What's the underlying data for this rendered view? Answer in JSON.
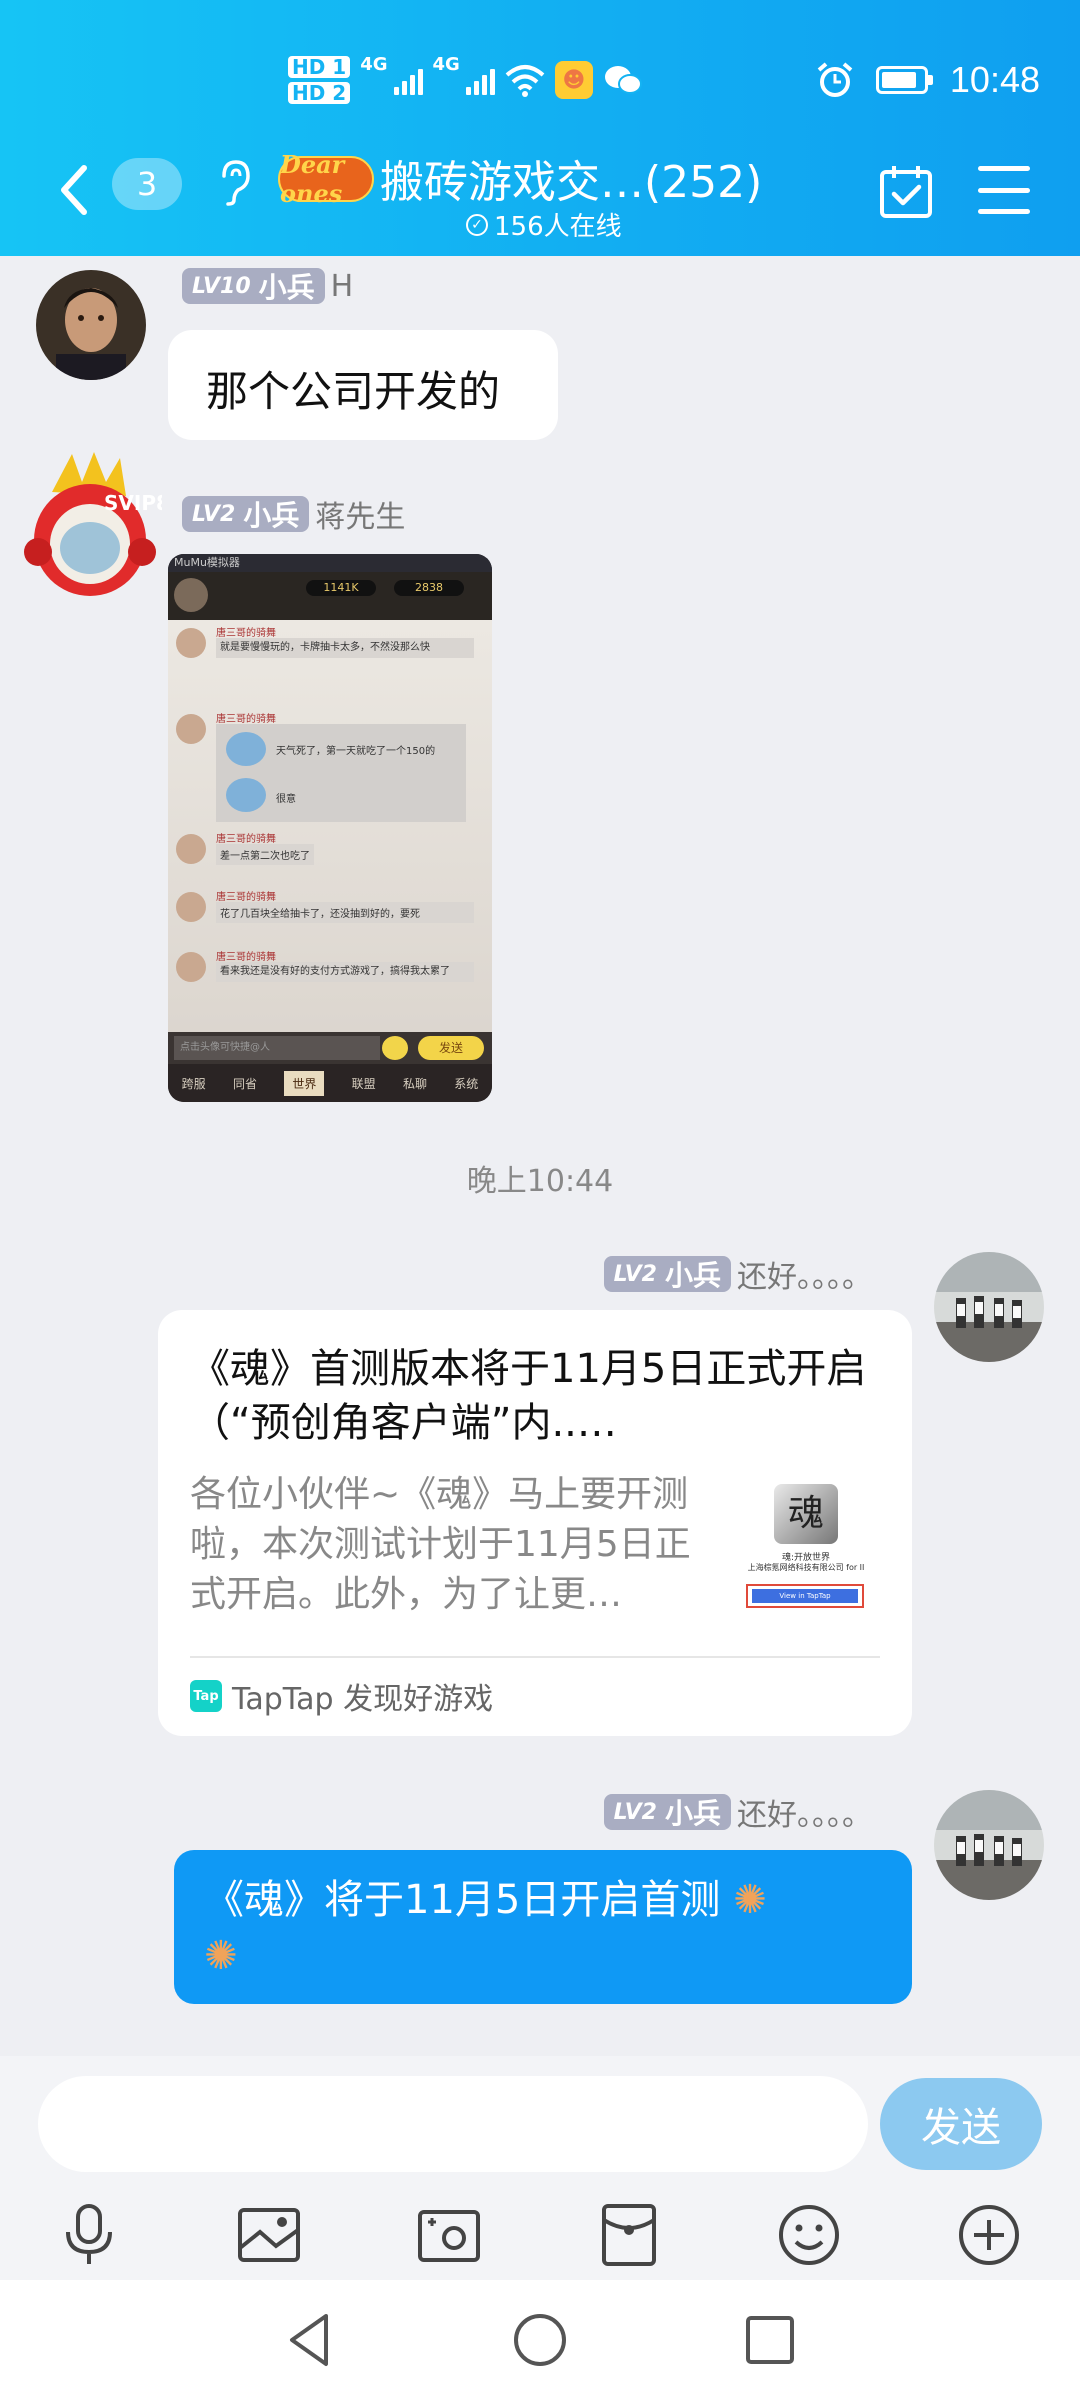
{
  "status_bar": {
    "hd1": "HD 1",
    "hd2": "HD 2",
    "net1": "4G",
    "net2": "4G",
    "time": "10:48"
  },
  "header": {
    "unread_count": "3",
    "group_logo_text": "Dear ones",
    "title": "搬砖游戏交…(252)",
    "online": "156人在线"
  },
  "messages": [
    {
      "level": "LV10",
      "rank": "小兵",
      "nickname": "H",
      "text": "那个公司开发的"
    },
    {
      "level": "LV2",
      "rank": "小兵",
      "nickname": "蒋先生",
      "image": {
        "app_title": "MuMu模拟器",
        "coins": "1141K",
        "gems": "2838",
        "lines": [
          {
            "name": "唐三哥的骑舞",
            "text": "就是要慢慢玩的，卡牌抽卡太多，不然没那么快"
          },
          {
            "name": "唐三哥的骑舞",
            "text": "天气死了，第一天就吃了一个150的"
          },
          {
            "name": "",
            "text": "很意"
          },
          {
            "name": "唐三哥的骑舞",
            "text": "差一点第二次也吃了"
          },
          {
            "name": "唐三哥的骑舞",
            "text": "花了几百块全给抽卡了，还没抽到好的，要死"
          },
          {
            "name": "唐三哥的骑舞",
            "text": "看来我还是没有好的支付方式游戏了，搞得我太累了"
          }
        ],
        "input_placeholder": "点击头像可快捷@人",
        "send": "发送",
        "tabs": [
          "跨服",
          "同省",
          "世界",
          "联盟",
          "私聊",
          "系统"
        ]
      }
    }
  ],
  "timestamp": "晚上10:44",
  "outgoing": [
    {
      "level": "LV2",
      "rank": "小兵",
      "nickname": "还好。。。。",
      "card": {
        "title": "《魂》首测版本将于11月5日正式开启（“预创角客户端”内..…",
        "desc": "各位小伙伴~《魂》马上要开测啦，本次测试计划于11月5日正式开启。此外，为了让更…",
        "thumb_caption": "魂:开放世界",
        "thumb_company": "上海棕氪网络科技有限公司 for II",
        "thumb_button": "View in TapTap",
        "source": "TapTap 发现好游戏"
      }
    },
    {
      "level": "LV2",
      "rank": "小兵",
      "nickname": "还好。。。。",
      "text": "《魂》将于11月5日开启首测"
    }
  ],
  "input_bar": {
    "placeholder": "",
    "send_label": "发送"
  }
}
